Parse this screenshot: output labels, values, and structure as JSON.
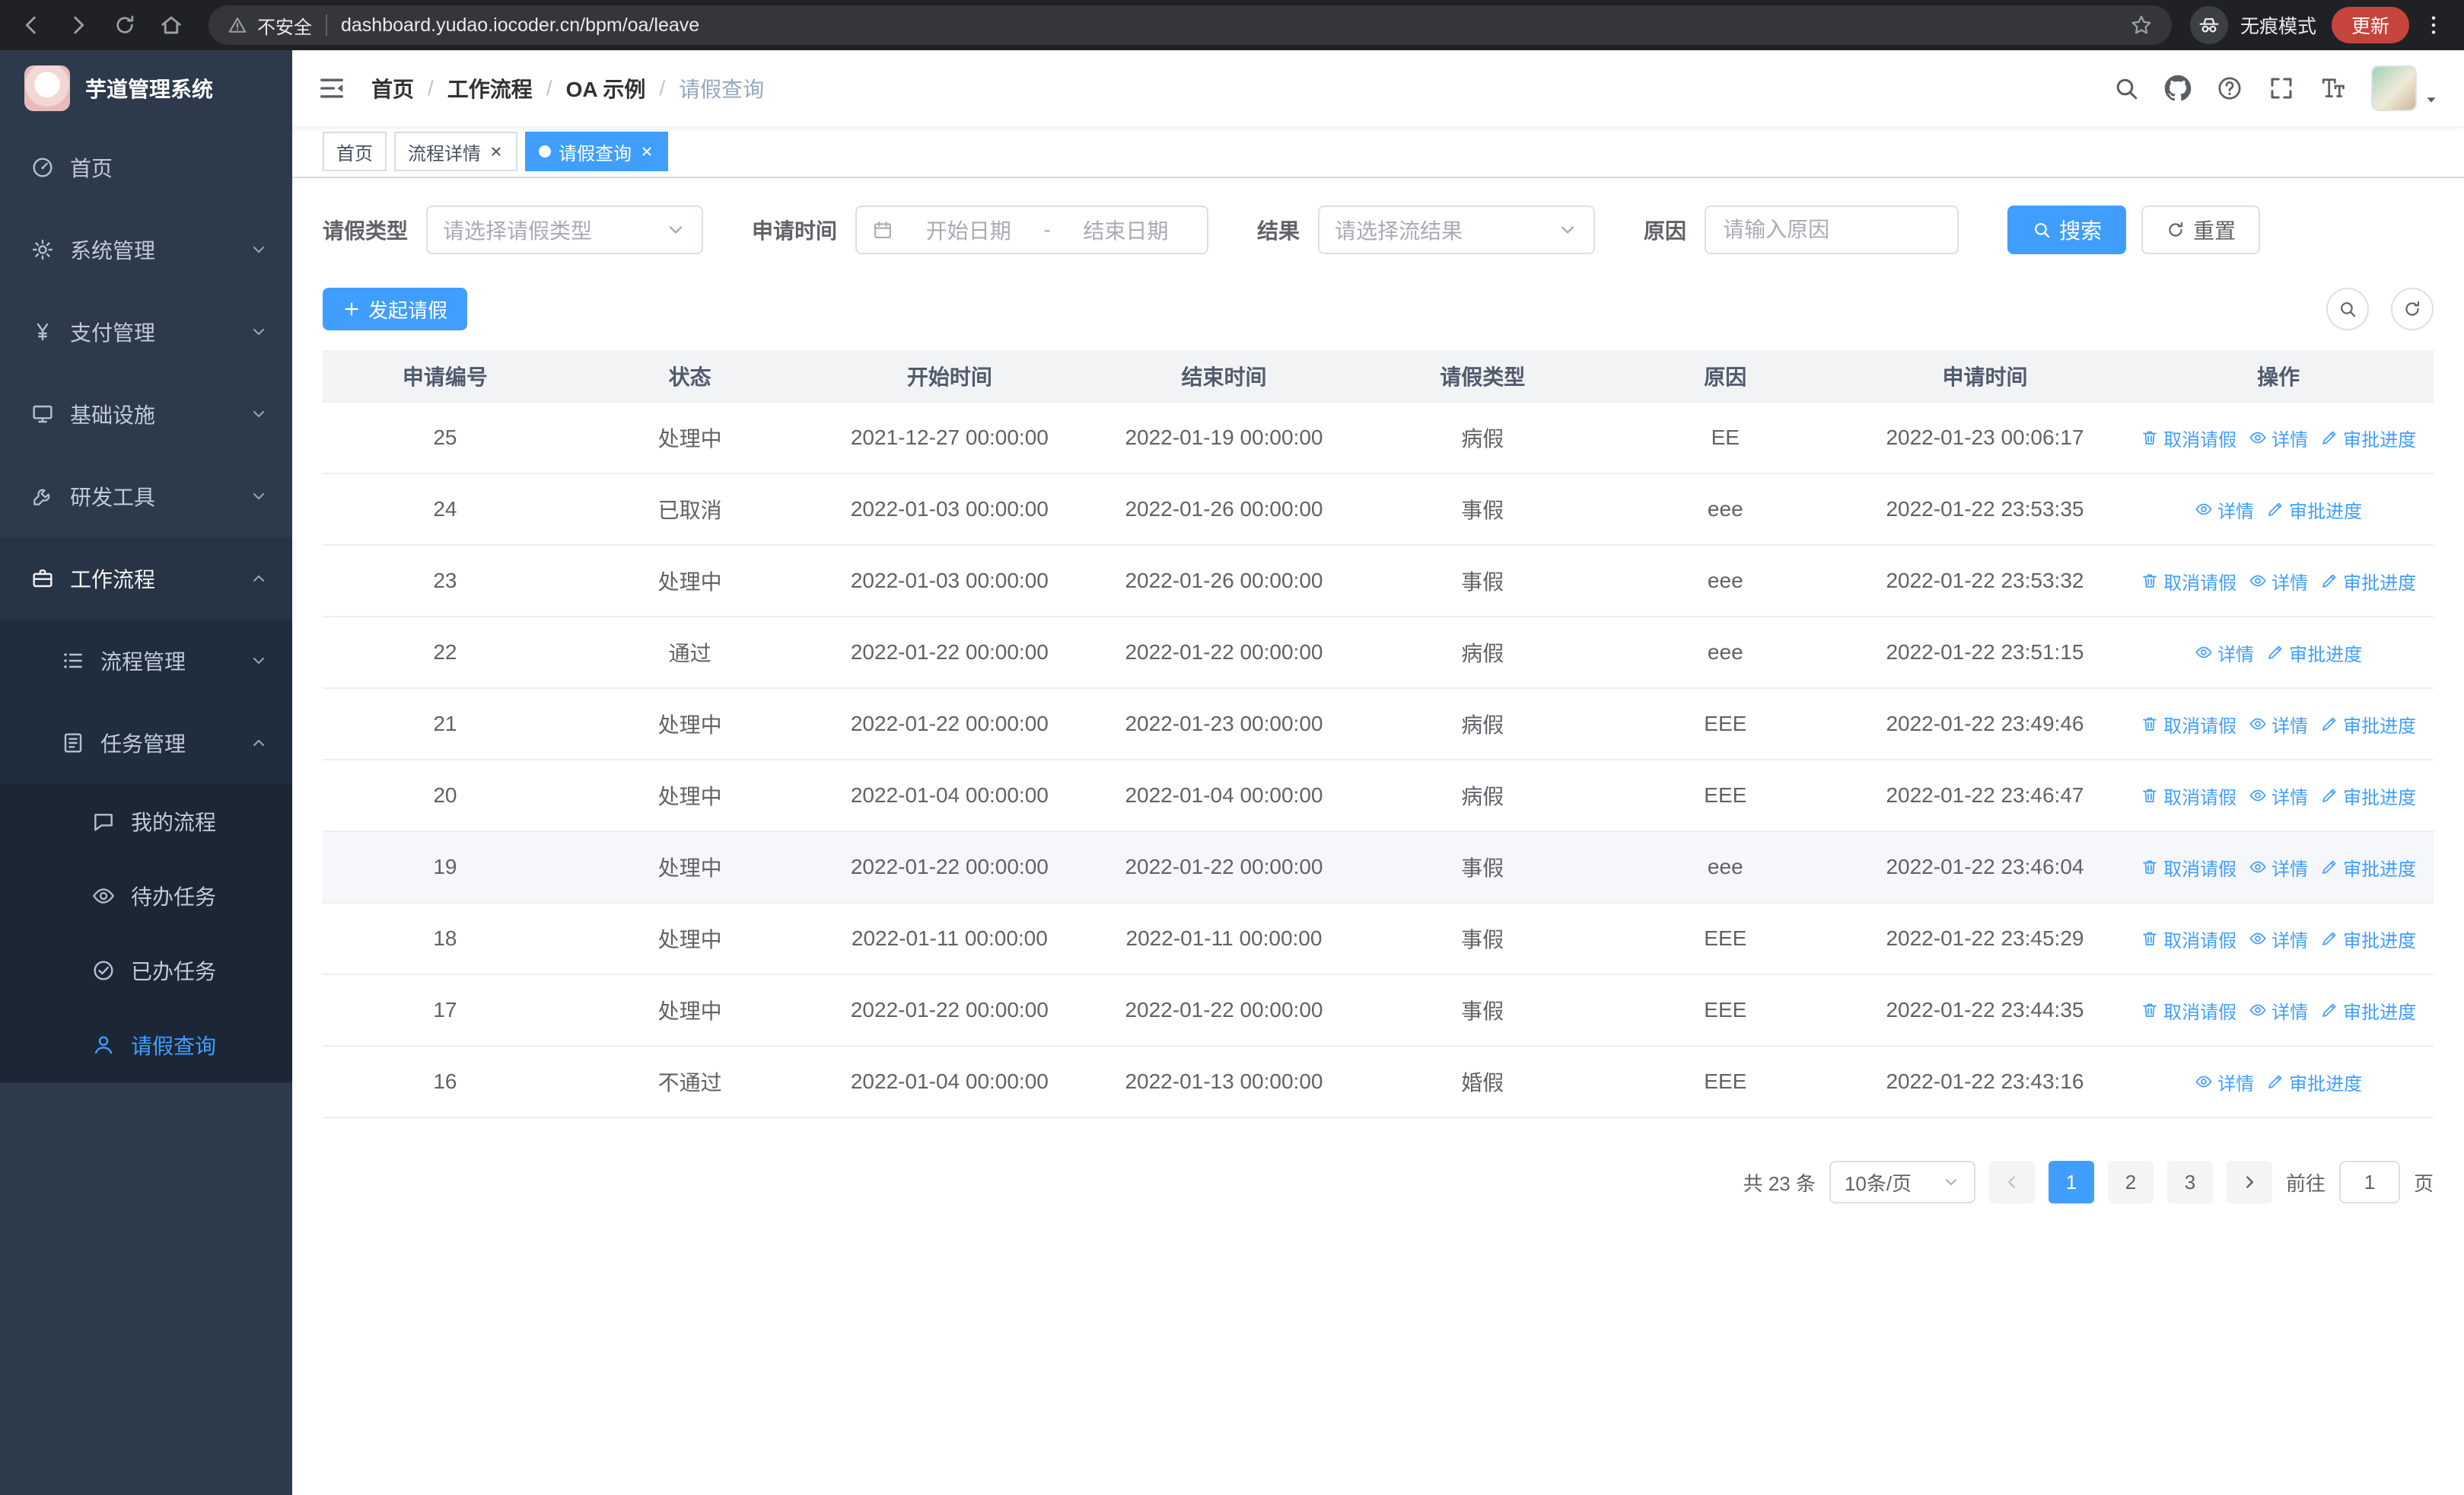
{
  "theme": {
    "primary": "#409eff",
    "sidebar_bg": "#2d3a4b",
    "submenu_bg": "#1f2d3d",
    "chrome_bg": "#202124",
    "table_header_bg": "#f2f3f5"
  },
  "browser": {
    "security_label": "不安全",
    "url": "dashboard.yudao.iocoder.cn/bpm/oa/leave",
    "incognito_label": "无痕模式",
    "update_label": "更新"
  },
  "sidebar": {
    "logo_title": "芋道管理系统",
    "items": [
      {
        "label": "首页"
      },
      {
        "label": "系统管理"
      },
      {
        "label": "支付管理"
      },
      {
        "label": "基础设施"
      },
      {
        "label": "研发工具"
      },
      {
        "label": "工作流程"
      },
      {
        "label": "流程管理"
      },
      {
        "label": "任务管理"
      },
      {
        "label": "我的流程"
      },
      {
        "label": "待办任务"
      },
      {
        "label": "已办任务"
      },
      {
        "label": "请假查询"
      }
    ]
  },
  "header": {
    "breadcrumb_separator": "/",
    "breadcrumb": [
      {
        "label": "首页"
      },
      {
        "label": "工作流程"
      },
      {
        "label": "OA 示例"
      },
      {
        "label": "请假查询"
      }
    ]
  },
  "tabs": [
    {
      "label": "首页"
    },
    {
      "label": "流程详情"
    },
    {
      "label": "请假查询"
    }
  ],
  "filters": {
    "leave_type_label": "请假类型",
    "leave_type_placeholder": "请选择请假类型",
    "apply_time_label": "申请时间",
    "date_start_placeholder": "开始日期",
    "date_separator": "-",
    "date_end_placeholder": "结束日期",
    "result_label": "结果",
    "result_placeholder": "请选择流结果",
    "reason_label": "原因",
    "reason_placeholder": "请输入原因",
    "search_button": "搜索",
    "reset_button": "重置"
  },
  "toolbar": {
    "create_button": "发起请假"
  },
  "table": {
    "columns": [
      "申请编号",
      "状态",
      "开始时间",
      "结束时间",
      "请假类型",
      "原因",
      "申请时间",
      "操作"
    ],
    "action_labels": {
      "cancel": "取消请假",
      "detail": "详情",
      "progress": "审批进度"
    },
    "rows": [
      {
        "id": "25",
        "status": "处理中",
        "start": "2021-12-27 00:00:00",
        "end": "2022-01-19 00:00:00",
        "type": "病假",
        "reason": "EE",
        "applied": "2022-01-23 00:06:17",
        "actions": [
          "cancel",
          "detail",
          "progress"
        ]
      },
      {
        "id": "24",
        "status": "已取消",
        "start": "2022-01-03 00:00:00",
        "end": "2022-01-26 00:00:00",
        "type": "事假",
        "reason": "eee",
        "applied": "2022-01-22 23:53:35",
        "actions": [
          "detail",
          "progress"
        ]
      },
      {
        "id": "23",
        "status": "处理中",
        "start": "2022-01-03 00:00:00",
        "end": "2022-01-26 00:00:00",
        "type": "事假",
        "reason": "eee",
        "applied": "2022-01-22 23:53:32",
        "actions": [
          "cancel",
          "detail",
          "progress"
        ]
      },
      {
        "id": "22",
        "status": "通过",
        "start": "2022-01-22 00:00:00",
        "end": "2022-01-22 00:00:00",
        "type": "病假",
        "reason": "eee",
        "applied": "2022-01-22 23:51:15",
        "actions": [
          "detail",
          "progress"
        ]
      },
      {
        "id": "21",
        "status": "处理中",
        "start": "2022-01-22 00:00:00",
        "end": "2022-01-23 00:00:00",
        "type": "病假",
        "reason": "EEE",
        "applied": "2022-01-22 23:49:46",
        "actions": [
          "cancel",
          "detail",
          "progress"
        ]
      },
      {
        "id": "20",
        "status": "处理中",
        "start": "2022-01-04 00:00:00",
        "end": "2022-01-04 00:00:00",
        "type": "病假",
        "reason": "EEE",
        "applied": "2022-01-22 23:46:47",
        "actions": [
          "cancel",
          "detail",
          "progress"
        ]
      },
      {
        "id": "19",
        "status": "处理中",
        "start": "2022-01-22 00:00:00",
        "end": "2022-01-22 00:00:00",
        "type": "事假",
        "reason": "eee",
        "applied": "2022-01-22 23:46:04",
        "actions": [
          "cancel",
          "detail",
          "progress"
        ],
        "highlighted": true
      },
      {
        "id": "18",
        "status": "处理中",
        "start": "2022-01-11 00:00:00",
        "end": "2022-01-11 00:00:00",
        "type": "事假",
        "reason": "EEE",
        "applied": "2022-01-22 23:45:29",
        "actions": [
          "cancel",
          "detail",
          "progress"
        ]
      },
      {
        "id": "17",
        "status": "处理中",
        "start": "2022-01-22 00:00:00",
        "end": "2022-01-22 00:00:00",
        "type": "事假",
        "reason": "EEE",
        "applied": "2022-01-22 23:44:35",
        "actions": [
          "cancel",
          "detail",
          "progress"
        ]
      },
      {
        "id": "16",
        "status": "不通过",
        "start": "2022-01-04 00:00:00",
        "end": "2022-01-13 00:00:00",
        "type": "婚假",
        "reason": "EEE",
        "applied": "2022-01-22 23:43:16",
        "actions": [
          "detail",
          "progress"
        ]
      }
    ]
  },
  "pagination": {
    "total_text": "共 23 条",
    "page_size_label": "10条/页",
    "pages": [
      "1",
      "2",
      "3"
    ],
    "active_page": "1",
    "goto_prefix": "前往",
    "goto_value": "1",
    "goto_suffix": "页"
  }
}
